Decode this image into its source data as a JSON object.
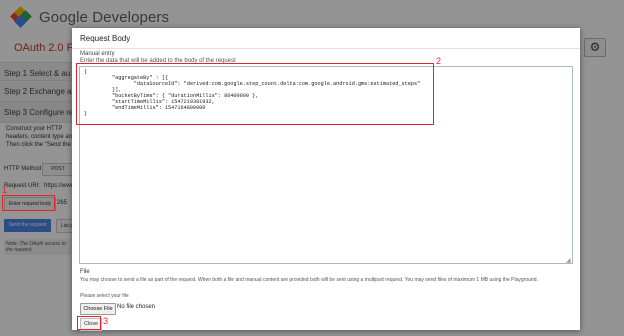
{
  "header": {
    "brand": "Google Developers"
  },
  "page": {
    "title": "OAuth 2.0 Pla",
    "steps": [
      {
        "label": "Step 1  Select & au"
      },
      {
        "label": "Step 2  Exchange a"
      },
      {
        "label": "Step 3  Configure re"
      }
    ],
    "step3_text": "Construct your HTTP headers, content type and Then click the \"Send the",
    "http_method_label": "HTTP Method",
    "http_method_value": "POST",
    "request_uri_label": "Request URI:",
    "request_uri_value": "https://www",
    "enter_body_button": "Enter request body",
    "body_size": "265",
    "send_button": "Send the request",
    "list_button": "List p",
    "note": "Note: The OAuth access to the request."
  },
  "dialog": {
    "title": "Request Body",
    "manual_entry_label": "Manual entry",
    "manual_entry_desc": "Enter the data that will be added to the body of the request",
    "body": "{\n         \"aggregateBy\" : [{\n                \"dataSourceId\": \"derived:com.google.step_count.delta:com.google.android.gms:estimated_steps\"\n         }],\n         \"bucketByTime\": { \"durationMillis\": 86400000 },\n         \"startTimeMillis\": 1547210381932,\n         \"endTimeMillis\": 1547164800000\n}",
    "file_label": "File",
    "file_desc": "You may choose to send a file as part of the request. When both a file and manual content are provided both will be sent using a multipart request. You may send files of maximum 1 MB using the Playground.",
    "select_file_label": "Please select your file",
    "choose_file_button": "Choose File",
    "no_file_text": "No file chosen",
    "close_button": "Close"
  },
  "annotations": {
    "one": "1",
    "two": "2",
    "three": "3"
  },
  "colors": {
    "accent": "#4a86e8",
    "annotation": "#e0262a",
    "title_red": "#c53929"
  }
}
